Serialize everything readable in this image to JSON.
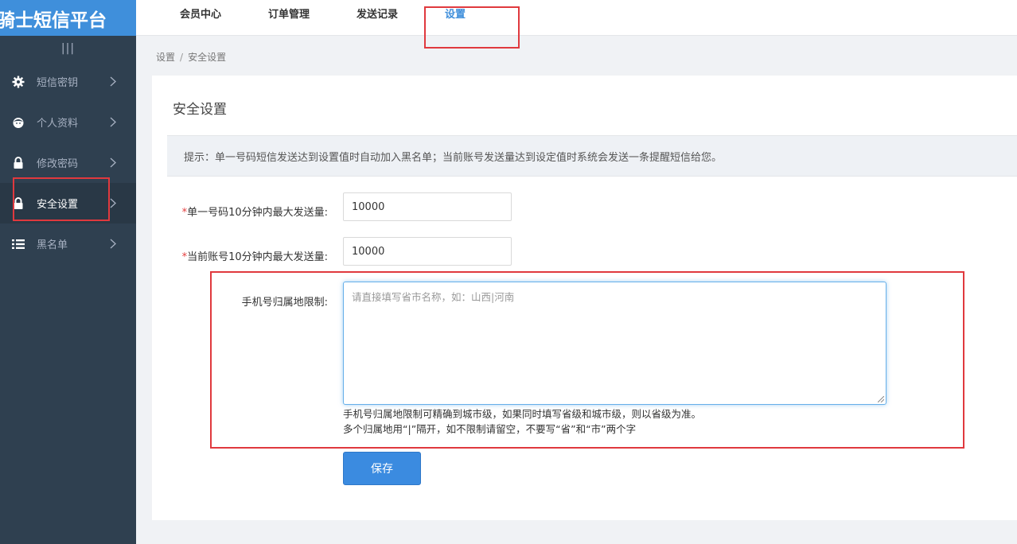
{
  "brand": {
    "title": "骑士短信平台"
  },
  "sidebar": {
    "collapse_glyph": "|||",
    "items": [
      {
        "label": "短信密钥",
        "icon": "gear-icon"
      },
      {
        "label": "个人资料",
        "icon": "user-icon"
      },
      {
        "label": "修改密码",
        "icon": "lock-icon"
      },
      {
        "label": "安全设置",
        "icon": "lock-icon",
        "active": true
      },
      {
        "label": "黑名单",
        "icon": "list-icon"
      }
    ]
  },
  "topnav": {
    "items": [
      {
        "label": "会员中心"
      },
      {
        "label": "订单管理"
      },
      {
        "label": "发送记录"
      },
      {
        "label": "设置",
        "active": true
      }
    ]
  },
  "breadcrumb": {
    "parent": "设置",
    "separator": "/",
    "current": "安全设置"
  },
  "main": {
    "title": "安全设置",
    "tip": "提示：单一号码短信发送达到设置值时自动加入黑名单；当前账号发送量达到设定值时系统会发送一条提醒短信给您。",
    "fields": {
      "single_limit": {
        "required_mark": "*",
        "label": "单一号码10分钟内最大发送量:",
        "value": "10000"
      },
      "account_limit": {
        "required_mark": "*",
        "label": "当前账号10分钟内最大发送量:",
        "value": "10000"
      },
      "region_limit": {
        "label": "手机号归属地限制:",
        "placeholder": "请直接填写省市名称，如：山西|河南",
        "value": "",
        "help_line1": "手机号归属地限制可精确到城市级，如果同时填写省级和城市级，则以省级为准。",
        "help_line2": "多个归属地用“|”隔开，如不限制请留空，不要写“省”和“市”两个字"
      }
    },
    "save_label": "保存"
  },
  "colors": {
    "sidebar_bg": "#2f4050",
    "brand_bg": "#3f8fdb",
    "accent": "#3b8be0",
    "highlight": "#e0393e"
  }
}
